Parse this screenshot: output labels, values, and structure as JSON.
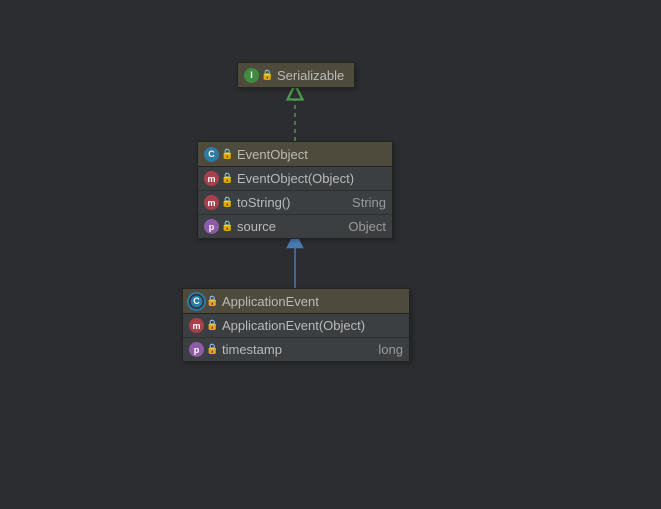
{
  "nodes": {
    "serializable": {
      "kind": "I",
      "name": "Serializable"
    },
    "eventObject": {
      "kind": "C",
      "name": "EventObject",
      "members": [
        {
          "badge": "m",
          "name": "EventObject(Object)",
          "type": ""
        },
        {
          "badge": "m",
          "name": "toString()",
          "type": "String"
        },
        {
          "badge": "p",
          "name": "source",
          "type": "Object"
        }
      ]
    },
    "applicationEvent": {
      "kind": "C",
      "name": "ApplicationEvent",
      "members": [
        {
          "badge": "m",
          "name": "ApplicationEvent(Object)",
          "type": ""
        },
        {
          "badge": "p",
          "name": "timestamp",
          "type": "long"
        }
      ]
    }
  }
}
